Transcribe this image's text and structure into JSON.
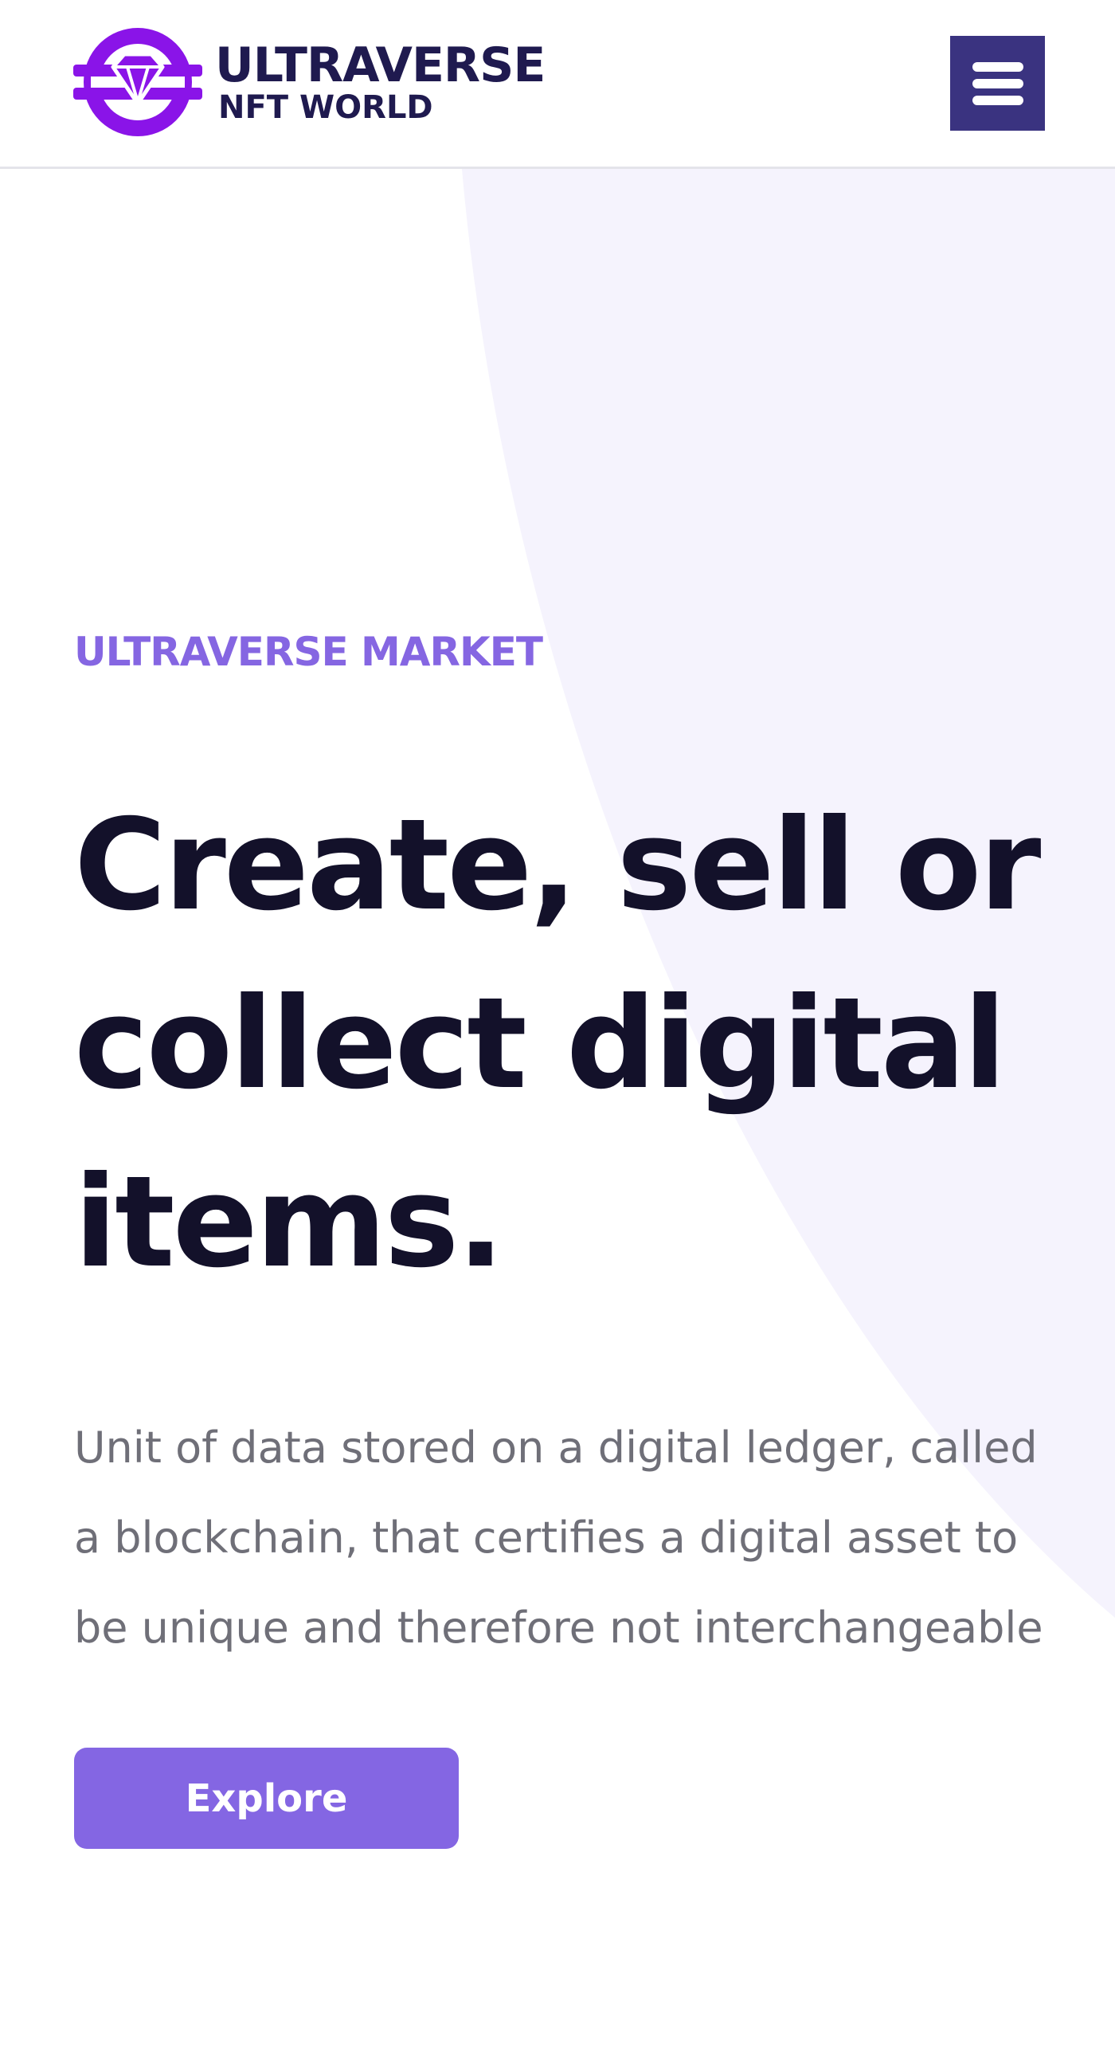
{
  "header": {
    "logo_title": "ULTRAVERSE",
    "logo_subtitle": "NFT WORLD"
  },
  "hero": {
    "eyebrow": "ULTRAVERSE MARKET",
    "headline_lines": [
      "Create, sell or",
      "collect digital",
      "items."
    ],
    "description": "Unit of data stored on a digital ledger, called a blockchain, that certifies a digital asset to be unique and therefore not interchangeable",
    "cta_label": "Explore"
  },
  "icons": {
    "logo": "diamond-ring-icon",
    "menu": "hamburger-menu-icon"
  },
  "colors": {
    "brand_purple": "#8a14e8",
    "brand_navy": "#1f1a4f",
    "menu_button": "#3a3380",
    "accent": "#8566e2",
    "headline": "#13112a",
    "body_text": "#6f6f78",
    "background_arc": "#f5f3fd"
  }
}
